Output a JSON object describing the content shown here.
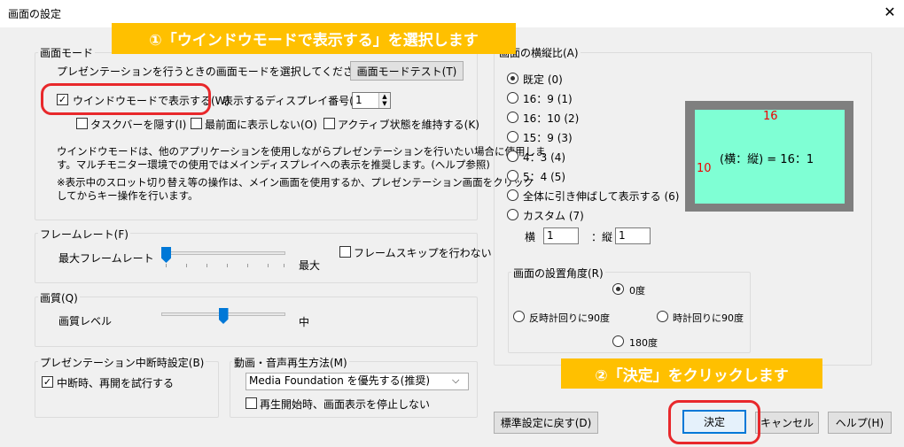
{
  "window": {
    "title": "画面の設定",
    "close_glyph": "✕"
  },
  "banners": {
    "step1": "①「ウインドウモードで表示する」を選択します",
    "step2": "②「決定」をクリックします"
  },
  "screen_mode": {
    "legend": "画面モード",
    "description": "プレゼンテーションを行うときの画面モードを選択してください",
    "test_button": "画面モードテスト(T)",
    "window_mode_label": "ウインドウモードで表示する(W)",
    "window_mode_checked": true,
    "display_number_label": "表示するディスプレイ番号(N)",
    "display_number_value": "1",
    "hide_taskbar": "タスクバーを隠す(I)",
    "not_topmost": "最前面に表示しない(O)",
    "keep_active": "アクティブ状態を維持する(K)",
    "note1_line1": "ウインドウモードは、他のアプリケーションを使用しながらプレゼンテーションを行いたい場合に使用しま",
    "note1_line2": "す。マルチモニター環境での使用ではメインディスプレイへの表示を推奨します。(ヘルプ参照)",
    "note2_line1": "※表示中のスロット切り替え等の操作は、メイン画面を使用するか、プレゼンテーション画面をクリック",
    "note2_line2": "してからキー操作を行います。"
  },
  "frame_rate": {
    "legend": "フレームレート(F)",
    "label": "最大フレームレート",
    "max_label": "最大",
    "skip_label": "フレームスキップを行わない",
    "level": 0.0
  },
  "quality": {
    "legend": "画質(Q)",
    "label": "画質レベル",
    "mid_label": "中",
    "level": 0.5
  },
  "interrupt": {
    "legend": "プレゼンテーション中断時設定(B)",
    "retry_label": "中断時、再開を試行する",
    "retry_checked": true
  },
  "media": {
    "legend": "動画・音声再生方法(M)",
    "selected": "Media Foundation を優先する(推奨)",
    "stop_label": "再生開始時、画面表示を停止しない"
  },
  "aspect": {
    "legend": "画面の横縦比(A)",
    "options": [
      "既定 (0)",
      "16：9 (1)",
      "16：10 (2)",
      "15：9 (3)",
      "4：3 (4)",
      "5：4 (5)",
      "全体に引き伸ばして表示する (6)",
      "カスタム (7)"
    ],
    "selected_index": 0,
    "width_label": "横",
    "width_value": "1",
    "height_label": "：縦",
    "height_value": "1",
    "preview_top": "16",
    "preview_left": "10",
    "preview_center": "(横：縦) = 16：1"
  },
  "rotation": {
    "legend": "画面の設置角度(R)",
    "deg0": "0度",
    "ccw90": "反時計回りに90度",
    "cw90": "時計回りに90度",
    "deg180": "180度"
  },
  "footer": {
    "reset": "標準設定に戻す(D)",
    "ok": "決定",
    "cancel": "キャンセル",
    "help": "ヘルプ(H)"
  },
  "colors": {
    "banner": "#ffc000",
    "highlight": "#e8282b",
    "preview_fill": "#7fffd4",
    "preview_frame": "#7f7f7f"
  }
}
